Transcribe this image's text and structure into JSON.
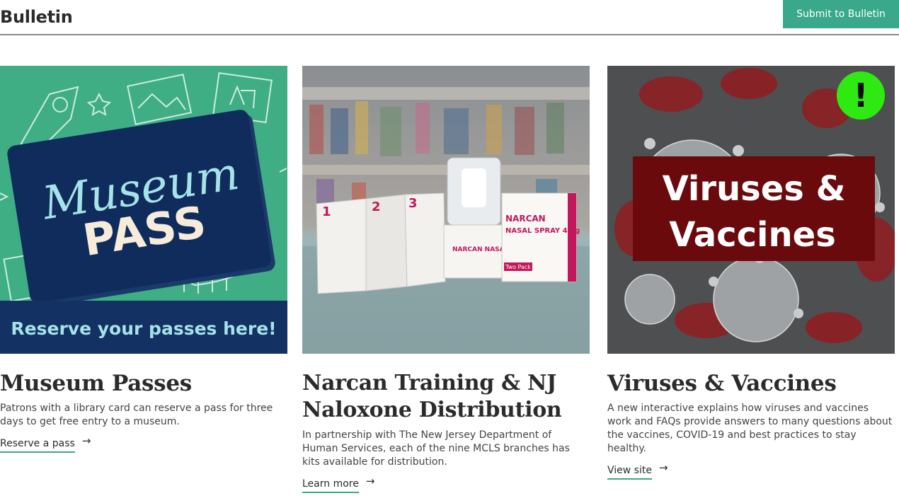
{
  "header": {
    "title": "Bulletin",
    "submit_label": "Submit to Bulletin"
  },
  "colors": {
    "accent": "#3aa88a",
    "text": "#2b2b2b"
  },
  "cards": [
    {
      "title": "Museum Passes",
      "description": "Patrons with a library card can reserve a pass for three days to get free entry to a museum.",
      "link_label": "Reserve a pass",
      "image": {
        "script_text": "Museum",
        "big_text": "PASS",
        "banner_text": "Reserve your passes here!"
      }
    },
    {
      "title": "Narcan Training & NJ Naloxone Distribution",
      "description": "In partnership with The New Jersey Department of Human Services, each of the nine MCLS branches has kits available for distribution.",
      "link_label": "Learn more",
      "image": {
        "box_brand": "NARCAN",
        "box_product": "NASAL SPRAY 4mg",
        "box_pack": "Two Pack",
        "small_box_text": "NARCAN NASAL SPRAY"
      }
    },
    {
      "title": "Viruses & Vaccines",
      "description": "A new interactive explains how viruses and vaccines work and FAQs provide answers to many questions about the vaccines, COVID-19 and best practices to stay healthy.",
      "link_label": "View site",
      "image": {
        "line1": "Viruses &",
        "line2": "Vaccines",
        "badge": "!"
      }
    }
  ]
}
